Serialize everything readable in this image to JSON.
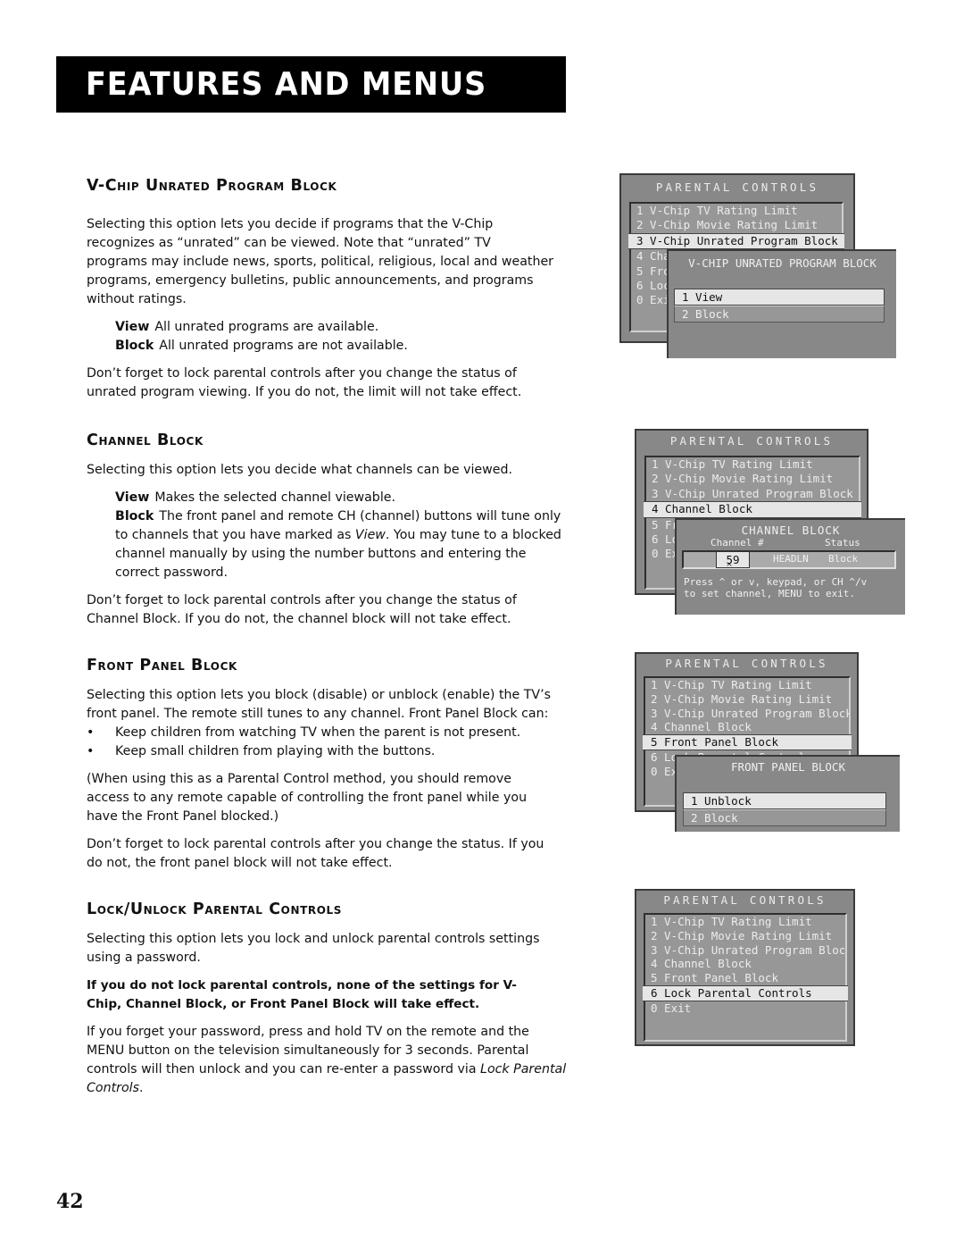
{
  "header": {
    "title": "FEATURES AND MENUS"
  },
  "sections": {
    "vchip": {
      "heading": "V-Chip Unrated Program Block",
      "intro": [
        "Selecting this option lets you decide if programs that the V-Chip",
        "recognizes as “unrated” can be viewed. Note that “unrated” TV",
        "programs may include news, sports, political, religious, local and weather",
        "programs, emergency bulletins, public announcements, and programs",
        "without ratings."
      ],
      "defs": [
        {
          "term": "View",
          "text": "All unrated programs are available."
        },
        {
          "term": "Block",
          "text": "All unrated programs are not available."
        }
      ],
      "note": [
        "Don’t forget to lock parental controls after you change the status of",
        "unrated program viewing. If you do not, the limit will not take effect."
      ]
    },
    "channel": {
      "heading": "Channel Block",
      "intro": "Selecting this option lets you decide what channels can be viewed.",
      "defs": [
        {
          "term": "View",
          "text": "Makes the selected channel viewable."
        },
        {
          "term": "Block",
          "text": "The front panel and remote CH (channel) buttons will tune only to channels that you have marked as ",
          "em": "View",
          "text2": ".  You may tune to a blocked channel manually by using the number buttons and entering the correct password."
        }
      ],
      "note": [
        "Don’t forget to lock parental controls after you change the status of",
        "Channel Block. If you do not, the channel block will not take effect."
      ]
    },
    "frontpanel": {
      "heading": "Front Panel Block",
      "intro": [
        "Selecting this option lets you block (disable) or unblock (enable) the TV’s",
        "front panel. The remote still tunes to any channel. Front Panel Block can:"
      ],
      "bullets": [
        "Keep children from watching TV when the parent is not present.",
        "Keep small children from playing with the buttons."
      ],
      "aside": [
        "(When using this as a Parental Control method, you should remove",
        "access to any remote capable of controlling the front panel while you",
        "have the Front Panel blocked.)"
      ],
      "note": [
        "Don’t forget to lock parental controls after you change the status. If you",
        "do not, the front panel block will not take effect."
      ]
    },
    "lock": {
      "heading": "Lock/Unlock Parental Controls",
      "intro": [
        "Selecting this option lets you lock and unlock parental controls settings",
        "using a password."
      ],
      "warning": [
        "If you do not lock parental controls, none of the settings for V-",
        "Chip, Channel Block, or Front Panel Block will take effect."
      ],
      "reset": [
        "If you forget your password, press and hold TV on the remote and the",
        "MENU button on the television simultaneously for 3 seconds. Parental",
        "controls will then unlock and you can re-enter a password via "
      ],
      "reset_em": "Lock Parental Controls",
      "reset_end": "."
    }
  },
  "osd": {
    "menu_title": "PARENTAL CONTROLS",
    "menu_items": [
      "1 V-Chip TV Rating Limit",
      "2 V-Chip Movie Rating Limit",
      "3 V-Chip Unrated Program Block",
      "4 Channel Block",
      "5 Front Panel Block",
      "6 Lock Parental Controls",
      "0 Exit"
    ],
    "screen1": {
      "selected_index": 2,
      "sub_title": "V-CHIP UNRATED PROGRAM BLOCK",
      "options": [
        "1 View",
        "2 Block"
      ],
      "selected_option": 0
    },
    "screen2": {
      "selected_index": 3,
      "sub_title": "CHANNEL BLOCK",
      "col_channel": "Channel #",
      "col_status": "Status",
      "channel": "59",
      "caret": "^",
      "station": "HEADLN",
      "status": "Block",
      "hint": [
        "Press ^ or v, keypad, or CH ^/v",
        "to set channel, MENU to exit."
      ]
    },
    "screen3": {
      "selected_index": 4,
      "sub_title": "FRONT PANEL BLOCK",
      "options": [
        "1 Unblock",
        "2 Block"
      ],
      "selected_option": 0
    },
    "screen4": {
      "selected_index": 5
    }
  },
  "page_number": "42"
}
